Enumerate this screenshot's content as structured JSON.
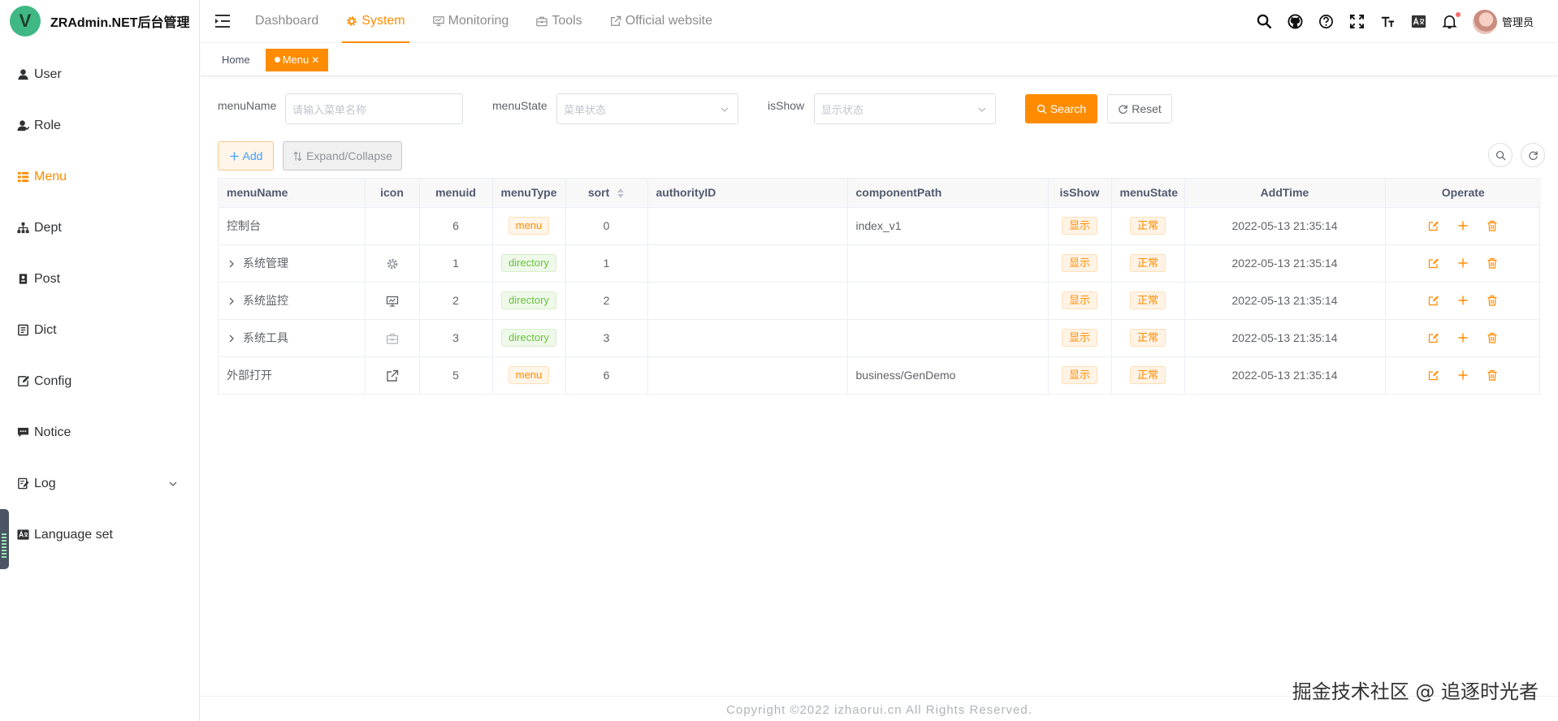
{
  "app": {
    "logo_letter": "V",
    "title": "ZRAdmin.NET后台管理"
  },
  "sidebar": {
    "items": [
      {
        "label": "User",
        "icon": "user-icon"
      },
      {
        "label": "Role",
        "icon": "role-icon"
      },
      {
        "label": "Menu",
        "icon": "tree-table-icon",
        "active": true
      },
      {
        "label": "Dept",
        "icon": "org-tree-icon"
      },
      {
        "label": "Post",
        "icon": "post-icon"
      },
      {
        "label": "Dict",
        "icon": "dict-icon"
      },
      {
        "label": "Config",
        "icon": "edit-icon"
      },
      {
        "label": "Notice",
        "icon": "message-icon"
      },
      {
        "label": "Log",
        "icon": "log-icon",
        "has_children": true
      },
      {
        "label": "Language set",
        "icon": "language-icon"
      }
    ]
  },
  "topnav": {
    "tabs": [
      {
        "label": "Dashboard"
      },
      {
        "label": "System",
        "active": true
      },
      {
        "label": "Monitoring"
      },
      {
        "label": "Tools"
      },
      {
        "label": "Official website"
      }
    ],
    "user_name": "管理员"
  },
  "tags": [
    {
      "label": "Home"
    },
    {
      "label": "Menu",
      "active": true
    }
  ],
  "search": {
    "menuName_label": "menuName",
    "menuName_placeholder": "请输入菜单名称",
    "menuState_label": "menuState",
    "menuState_placeholder": "菜单状态",
    "isShow_label": "isShow",
    "isShow_placeholder": "显示状态",
    "search_btn": "Search",
    "reset_btn": "Reset"
  },
  "toolbar": {
    "add_btn": "Add",
    "expand_btn": "Expand/Collapse"
  },
  "table": {
    "headers": {
      "menuName": "menuName",
      "icon": "icon",
      "menuid": "menuid",
      "menuType": "menuType",
      "sort": "sort",
      "authorityID": "authorityID",
      "componentPath": "componentPath",
      "isShow": "isShow",
      "menuState": "menuState",
      "addTime": "AddTime",
      "operate": "Operate"
    },
    "rows": [
      {
        "name": "控制台",
        "expandable": false,
        "icon": "",
        "menuid": "6",
        "type": "menu",
        "sort": "0",
        "authority": "",
        "path": "index_v1",
        "show": "显示",
        "state": "正常",
        "time": "2022-05-13 21:35:14"
      },
      {
        "name": "系统管理",
        "expandable": true,
        "icon": "system-icon",
        "menuid": "1",
        "type": "directory",
        "sort": "1",
        "authority": "",
        "path": "",
        "show": "显示",
        "state": "正常",
        "time": "2022-05-13 21:35:14"
      },
      {
        "name": "系统监控",
        "expandable": true,
        "icon": "monitor-icon",
        "menuid": "2",
        "type": "directory",
        "sort": "2",
        "authority": "",
        "path": "",
        "show": "显示",
        "state": "正常",
        "time": "2022-05-13 21:35:14"
      },
      {
        "name": "系统工具",
        "expandable": true,
        "icon": "tool-icon",
        "menuid": "3",
        "type": "directory",
        "sort": "3",
        "authority": "",
        "path": "",
        "show": "显示",
        "state": "正常",
        "time": "2022-05-13 21:35:14"
      },
      {
        "name": "外部打开",
        "expandable": false,
        "icon": "link-icon",
        "menuid": "5",
        "type": "menu",
        "sort": "6",
        "authority": "",
        "path": "business/GenDemo",
        "show": "显示",
        "state": "正常",
        "time": "2022-05-13 21:35:14"
      }
    ]
  },
  "footer": {
    "copyright": "Copyright ©2022 izhaorui.cn All Rights Reserved."
  },
  "watermark": "掘金技术社区 @ 追逐时光者",
  "colors": {
    "accent": "#ff8c00",
    "directory": "#67c23a",
    "link": "#409eff"
  }
}
